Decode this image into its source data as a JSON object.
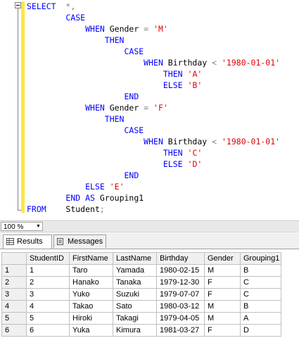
{
  "editor": {
    "lines": [
      [
        {
          "t": "SELECT",
          "c": "kw"
        },
        {
          "t": "  ",
          "c": "plain"
        },
        {
          "t": "*,",
          "c": "op"
        }
      ],
      [
        {
          "t": "        ",
          "c": "plain"
        },
        {
          "t": "CASE",
          "c": "kw"
        }
      ],
      [
        {
          "t": "            ",
          "c": "plain"
        },
        {
          "t": "WHEN",
          "c": "kw"
        },
        {
          "t": " Gender ",
          "c": "plain"
        },
        {
          "t": "=",
          "c": "op"
        },
        {
          "t": " ",
          "c": "plain"
        },
        {
          "t": "'M'",
          "c": "str"
        }
      ],
      [
        {
          "t": "                ",
          "c": "plain"
        },
        {
          "t": "THEN",
          "c": "kw"
        }
      ],
      [
        {
          "t": "                    ",
          "c": "plain"
        },
        {
          "t": "CASE",
          "c": "kw"
        }
      ],
      [
        {
          "t": "                        ",
          "c": "plain"
        },
        {
          "t": "WHEN",
          "c": "kw"
        },
        {
          "t": " Birthday ",
          "c": "plain"
        },
        {
          "t": "<",
          "c": "op"
        },
        {
          "t": " ",
          "c": "plain"
        },
        {
          "t": "'1980-01-01'",
          "c": "str"
        }
      ],
      [
        {
          "t": "                            ",
          "c": "plain"
        },
        {
          "t": "THEN",
          "c": "kw"
        },
        {
          "t": " ",
          "c": "plain"
        },
        {
          "t": "'A'",
          "c": "str"
        }
      ],
      [
        {
          "t": "                            ",
          "c": "plain"
        },
        {
          "t": "ELSE",
          "c": "kw"
        },
        {
          "t": " ",
          "c": "plain"
        },
        {
          "t": "'B'",
          "c": "str"
        }
      ],
      [
        {
          "t": "                    ",
          "c": "plain"
        },
        {
          "t": "END",
          "c": "kw"
        }
      ],
      [
        {
          "t": "            ",
          "c": "plain"
        },
        {
          "t": "WHEN",
          "c": "kw"
        },
        {
          "t": " Gender ",
          "c": "plain"
        },
        {
          "t": "=",
          "c": "op"
        },
        {
          "t": " ",
          "c": "plain"
        },
        {
          "t": "'F'",
          "c": "str"
        }
      ],
      [
        {
          "t": "                ",
          "c": "plain"
        },
        {
          "t": "THEN",
          "c": "kw"
        }
      ],
      [
        {
          "t": "                    ",
          "c": "plain"
        },
        {
          "t": "CASE",
          "c": "kw"
        }
      ],
      [
        {
          "t": "                        ",
          "c": "plain"
        },
        {
          "t": "WHEN",
          "c": "kw"
        },
        {
          "t": " Birthday ",
          "c": "plain"
        },
        {
          "t": "<",
          "c": "op"
        },
        {
          "t": " ",
          "c": "plain"
        },
        {
          "t": "'1980-01-01'",
          "c": "str"
        }
      ],
      [
        {
          "t": "                            ",
          "c": "plain"
        },
        {
          "t": "THEN",
          "c": "kw"
        },
        {
          "t": " ",
          "c": "plain"
        },
        {
          "t": "'C'",
          "c": "str"
        }
      ],
      [
        {
          "t": "                            ",
          "c": "plain"
        },
        {
          "t": "ELSE",
          "c": "kw"
        },
        {
          "t": " ",
          "c": "plain"
        },
        {
          "t": "'D'",
          "c": "str"
        }
      ],
      [
        {
          "t": "                    ",
          "c": "plain"
        },
        {
          "t": "END",
          "c": "kw"
        }
      ],
      [
        {
          "t": "            ",
          "c": "plain"
        },
        {
          "t": "ELSE",
          "c": "kw"
        },
        {
          "t": " ",
          "c": "plain"
        },
        {
          "t": "'E'",
          "c": "str"
        }
      ],
      [
        {
          "t": "        ",
          "c": "plain"
        },
        {
          "t": "END",
          "c": "kw"
        },
        {
          "t": " ",
          "c": "plain"
        },
        {
          "t": "AS",
          "c": "kw"
        },
        {
          "t": " Grouping1",
          "c": "plain"
        }
      ],
      [
        {
          "t": "FROM",
          "c": "kw"
        },
        {
          "t": "    Student",
          "c": "plain"
        },
        {
          "t": ";",
          "c": "op"
        }
      ]
    ]
  },
  "zoom": {
    "value": "100 %"
  },
  "tabs": [
    {
      "label": "Results",
      "icon": "grid-icon",
      "active": true
    },
    {
      "label": "Messages",
      "icon": "messages-icon",
      "active": false
    }
  ],
  "results": {
    "columns": [
      "StudentID",
      "FirstName",
      "LastName",
      "Birthday",
      "Gender",
      "Grouping1"
    ],
    "rows": [
      {
        "num": "1",
        "cells": [
          "1",
          "Taro",
          "Yamada",
          "1980-02-15",
          "M",
          "B"
        ]
      },
      {
        "num": "2",
        "cells": [
          "2",
          "Hanako",
          "Tanaka",
          "1979-12-30",
          "F",
          "C"
        ]
      },
      {
        "num": "3",
        "cells": [
          "3",
          "Yuko",
          "Suzuki",
          "1979-07-07",
          "F",
          "C"
        ]
      },
      {
        "num": "4",
        "cells": [
          "4",
          "Takao",
          "Sato",
          "1980-03-12",
          "M",
          "B"
        ]
      },
      {
        "num": "5",
        "cells": [
          "5",
          "Hiroki",
          "Takagi",
          "1979-04-05",
          "M",
          "A"
        ]
      },
      {
        "num": "6",
        "cells": [
          "6",
          "Yuka",
          "Kimura",
          "1981-03-27",
          "F",
          "D"
        ]
      }
    ]
  }
}
